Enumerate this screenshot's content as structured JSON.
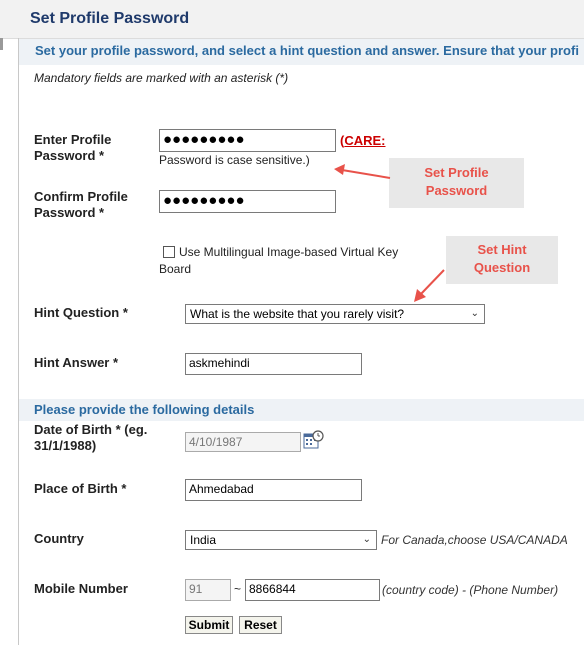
{
  "title": "Set Profile Password",
  "intro": "Set your profile password, and select a hint question and answer. Ensure that your profi",
  "mandatory_note": "Mandatory fields are marked with an asterisk (*)",
  "password": {
    "label_line1": "Enter Profile",
    "label_line2": "Password *",
    "value": "●●●●●●●●●",
    "care_paren": "(",
    "care_link": "CARE:",
    "case_note": "Password is case sensitive.)"
  },
  "confirm": {
    "label_line1": "Confirm Profile",
    "label_line2": "Password *",
    "value": "●●●●●●●●●"
  },
  "keyboard": {
    "line1": "Use Multilingual Image-based Virtual Key",
    "line2": "Board"
  },
  "callouts": {
    "password_line1": "Set Profile",
    "password_line2": "Password",
    "hint_line1": "Set Hint",
    "hint_line2": "Question"
  },
  "hint_question": {
    "label": "Hint Question *",
    "value": "What is the website that you rarely visit?"
  },
  "hint_answer": {
    "label": "Hint Answer *",
    "value": "askmehindi"
  },
  "details_heading": "Please provide the following details",
  "dob": {
    "label_line1": "Date of Birth * (eg.",
    "label_line2": "31/1/1988)",
    "value": "4/10/1987"
  },
  "place_of_birth": {
    "label": "Place of Birth *",
    "value": "Ahmedabad"
  },
  "country": {
    "label": "Country",
    "value": "India",
    "note": "For Canada,choose USA/CANADA"
  },
  "mobile": {
    "label": "Mobile Number",
    "country_code": "91",
    "separator": "~",
    "number": "8866844",
    "hint": "(country code) - (Phone Number)"
  },
  "buttons": {
    "submit": "Submit",
    "reset": "Reset"
  },
  "colors": {
    "heading_blue": "#2b6aa0",
    "title_blue": "#1f3a6b",
    "callout_red": "#e8524a",
    "care_red": "#cc0000"
  }
}
